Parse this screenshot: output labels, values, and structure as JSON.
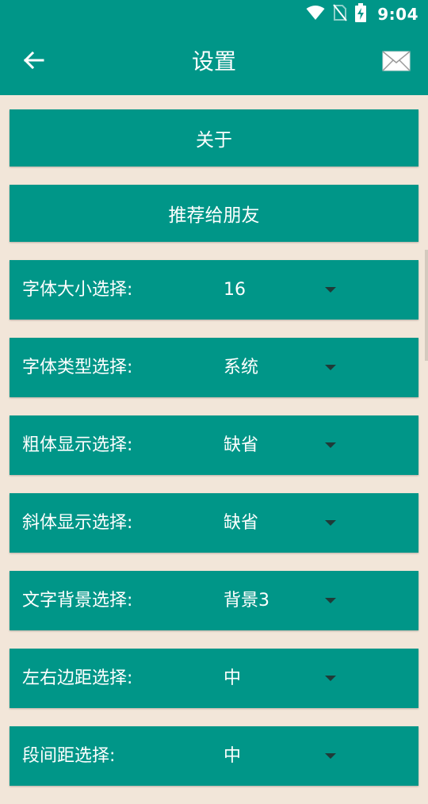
{
  "status_bar": {
    "time": "9:04"
  },
  "app_bar": {
    "title": "设置"
  },
  "buttons": {
    "about": "关于",
    "recommend": "推荐给朋友"
  },
  "settings": [
    {
      "label": "字体大小选择:",
      "value": "16"
    },
    {
      "label": "字体类型选择:",
      "value": "系统"
    },
    {
      "label": "粗体显示选择:",
      "value": "缺省"
    },
    {
      "label": "斜体显示选择:",
      "value": "缺省"
    },
    {
      "label": "文字背景选择:",
      "value": "背景3"
    },
    {
      "label": "左右边距选择:",
      "value": "中"
    },
    {
      "label": "段间距选择:",
      "value": "中"
    }
  ],
  "colors": {
    "primary": "#009688",
    "background": "#f2e6d9",
    "caret": "#1f3b38"
  }
}
